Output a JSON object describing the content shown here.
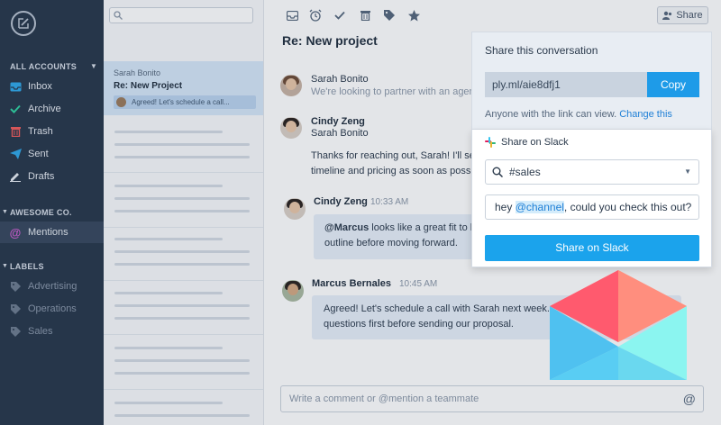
{
  "sidebar": {
    "sections": {
      "accounts": "ALL ACCOUNTS",
      "awesome": "AWESOME CO.",
      "labels": "LABELS"
    },
    "items": [
      {
        "label": "Inbox",
        "icon": "inbox-icon",
        "color": "#2fa7e8"
      },
      {
        "label": "Archive",
        "icon": "check-icon",
        "color": "#2fd1a0"
      },
      {
        "label": "Trash",
        "icon": "trash-icon",
        "color": "#ef5b5b"
      },
      {
        "label": "Sent",
        "icon": "send-icon",
        "color": "#2fa7e8"
      },
      {
        "label": "Drafts",
        "icon": "pencil-icon",
        "color": "#e6ebf2"
      }
    ],
    "team_items": [
      {
        "label": "Mentions",
        "icon": "at-icon",
        "color": "#d35fd3"
      }
    ],
    "labels": [
      {
        "label": "Advertising",
        "icon": "tag-icon"
      },
      {
        "label": "Operations",
        "icon": "tag-icon"
      },
      {
        "label": "Sales",
        "icon": "tag-icon"
      }
    ]
  },
  "list": {
    "search_placeholder": "",
    "active": {
      "sender": "Sarah Bonito",
      "subject": "Re:  New Project",
      "preview": "Agreed! Let's schedule a call..."
    }
  },
  "main": {
    "share_label": "Share",
    "title": "Re: New project",
    "messages": [
      {
        "name": "Sarah Bonito",
        "preview": "We're looking to partner with an agency"
      },
      {
        "name": "Cindy Zeng",
        "to": "Sarah Bonito",
        "line1": "Thanks for reaching out, Sarah! I'll send over a",
        "line2": "timeline and pricing as soon as possible."
      },
      {
        "name": "Cindy Zeng",
        "time": "10:33 AM",
        "mention": "@Marcus",
        "line1_rest": " looks like a great fit to lead this",
        "line2": "outline before moving forward."
      },
      {
        "name": "Marcus Bernales",
        "time": "10:45 AM",
        "line1": "Agreed! Let's schedule a call with Sarah next week.",
        "line2": "questions first before sending our proposal."
      }
    ],
    "composer_placeholder": "Write a comment or @mention a teammate"
  },
  "share": {
    "title": "Share this conversation",
    "link": "ply.ml/aie8dfj1",
    "copy_label": "Copy",
    "note": "Anyone with the link can view.",
    "change_label": "Change this",
    "slack_heading": "Share on Slack",
    "channel": "#sales",
    "message_prefix": "hey ",
    "message_channel": "@channel",
    "message_rest": ", could you check this out?",
    "button_label": "Share on Slack"
  }
}
